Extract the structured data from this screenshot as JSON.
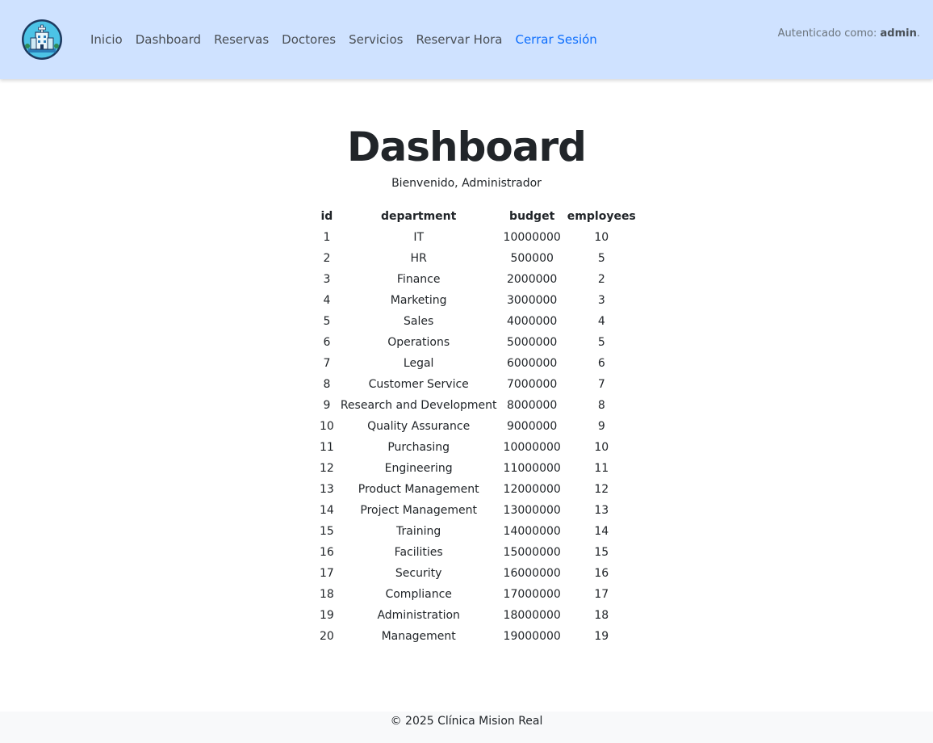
{
  "navbar": {
    "links": [
      "Inicio",
      "Dashboard",
      "Reservas",
      "Doctores",
      "Servicios",
      "Reservar Hora",
      "Cerrar Sesión"
    ],
    "auth_prefix": "Autenticado como: ",
    "auth_user": "admin",
    "auth_suffix": ".",
    "colors": {
      "background": "#cfe2ff",
      "link": "#4a4f55",
      "active_link": "#0d6efd"
    }
  },
  "main": {
    "title": "Dashboard",
    "subtitle": "Bienvenido, Administrador",
    "table": {
      "headers": [
        "id",
        "department",
        "budget",
        "employees"
      ],
      "rows": [
        [
          "1",
          "IT",
          "10000000",
          "10"
        ],
        [
          "2",
          "HR",
          "500000",
          "5"
        ],
        [
          "3",
          "Finance",
          "2000000",
          "2"
        ],
        [
          "4",
          "Marketing",
          "3000000",
          "3"
        ],
        [
          "5",
          "Sales",
          "4000000",
          "4"
        ],
        [
          "6",
          "Operations",
          "5000000",
          "5"
        ],
        [
          "7",
          "Legal",
          "6000000",
          "6"
        ],
        [
          "8",
          "Customer Service",
          "7000000",
          "7"
        ],
        [
          "9",
          "Research and Development",
          "8000000",
          "8"
        ],
        [
          "10",
          "Quality Assurance",
          "9000000",
          "9"
        ],
        [
          "11",
          "Purchasing",
          "10000000",
          "10"
        ],
        [
          "12",
          "Engineering",
          "11000000",
          "11"
        ],
        [
          "13",
          "Product Management",
          "12000000",
          "12"
        ],
        [
          "14",
          "Project Management",
          "13000000",
          "13"
        ],
        [
          "15",
          "Training",
          "14000000",
          "14"
        ],
        [
          "16",
          "Facilities",
          "15000000",
          "15"
        ],
        [
          "17",
          "Security",
          "16000000",
          "16"
        ],
        [
          "18",
          "Compliance",
          "17000000",
          "17"
        ],
        [
          "19",
          "Administration",
          "18000000",
          "18"
        ],
        [
          "20",
          "Management",
          "19000000",
          "19"
        ]
      ]
    }
  },
  "footer": {
    "text": "© 2025 Clínica Mision Real"
  },
  "icons": {
    "logo": "hospital-building-icon"
  }
}
